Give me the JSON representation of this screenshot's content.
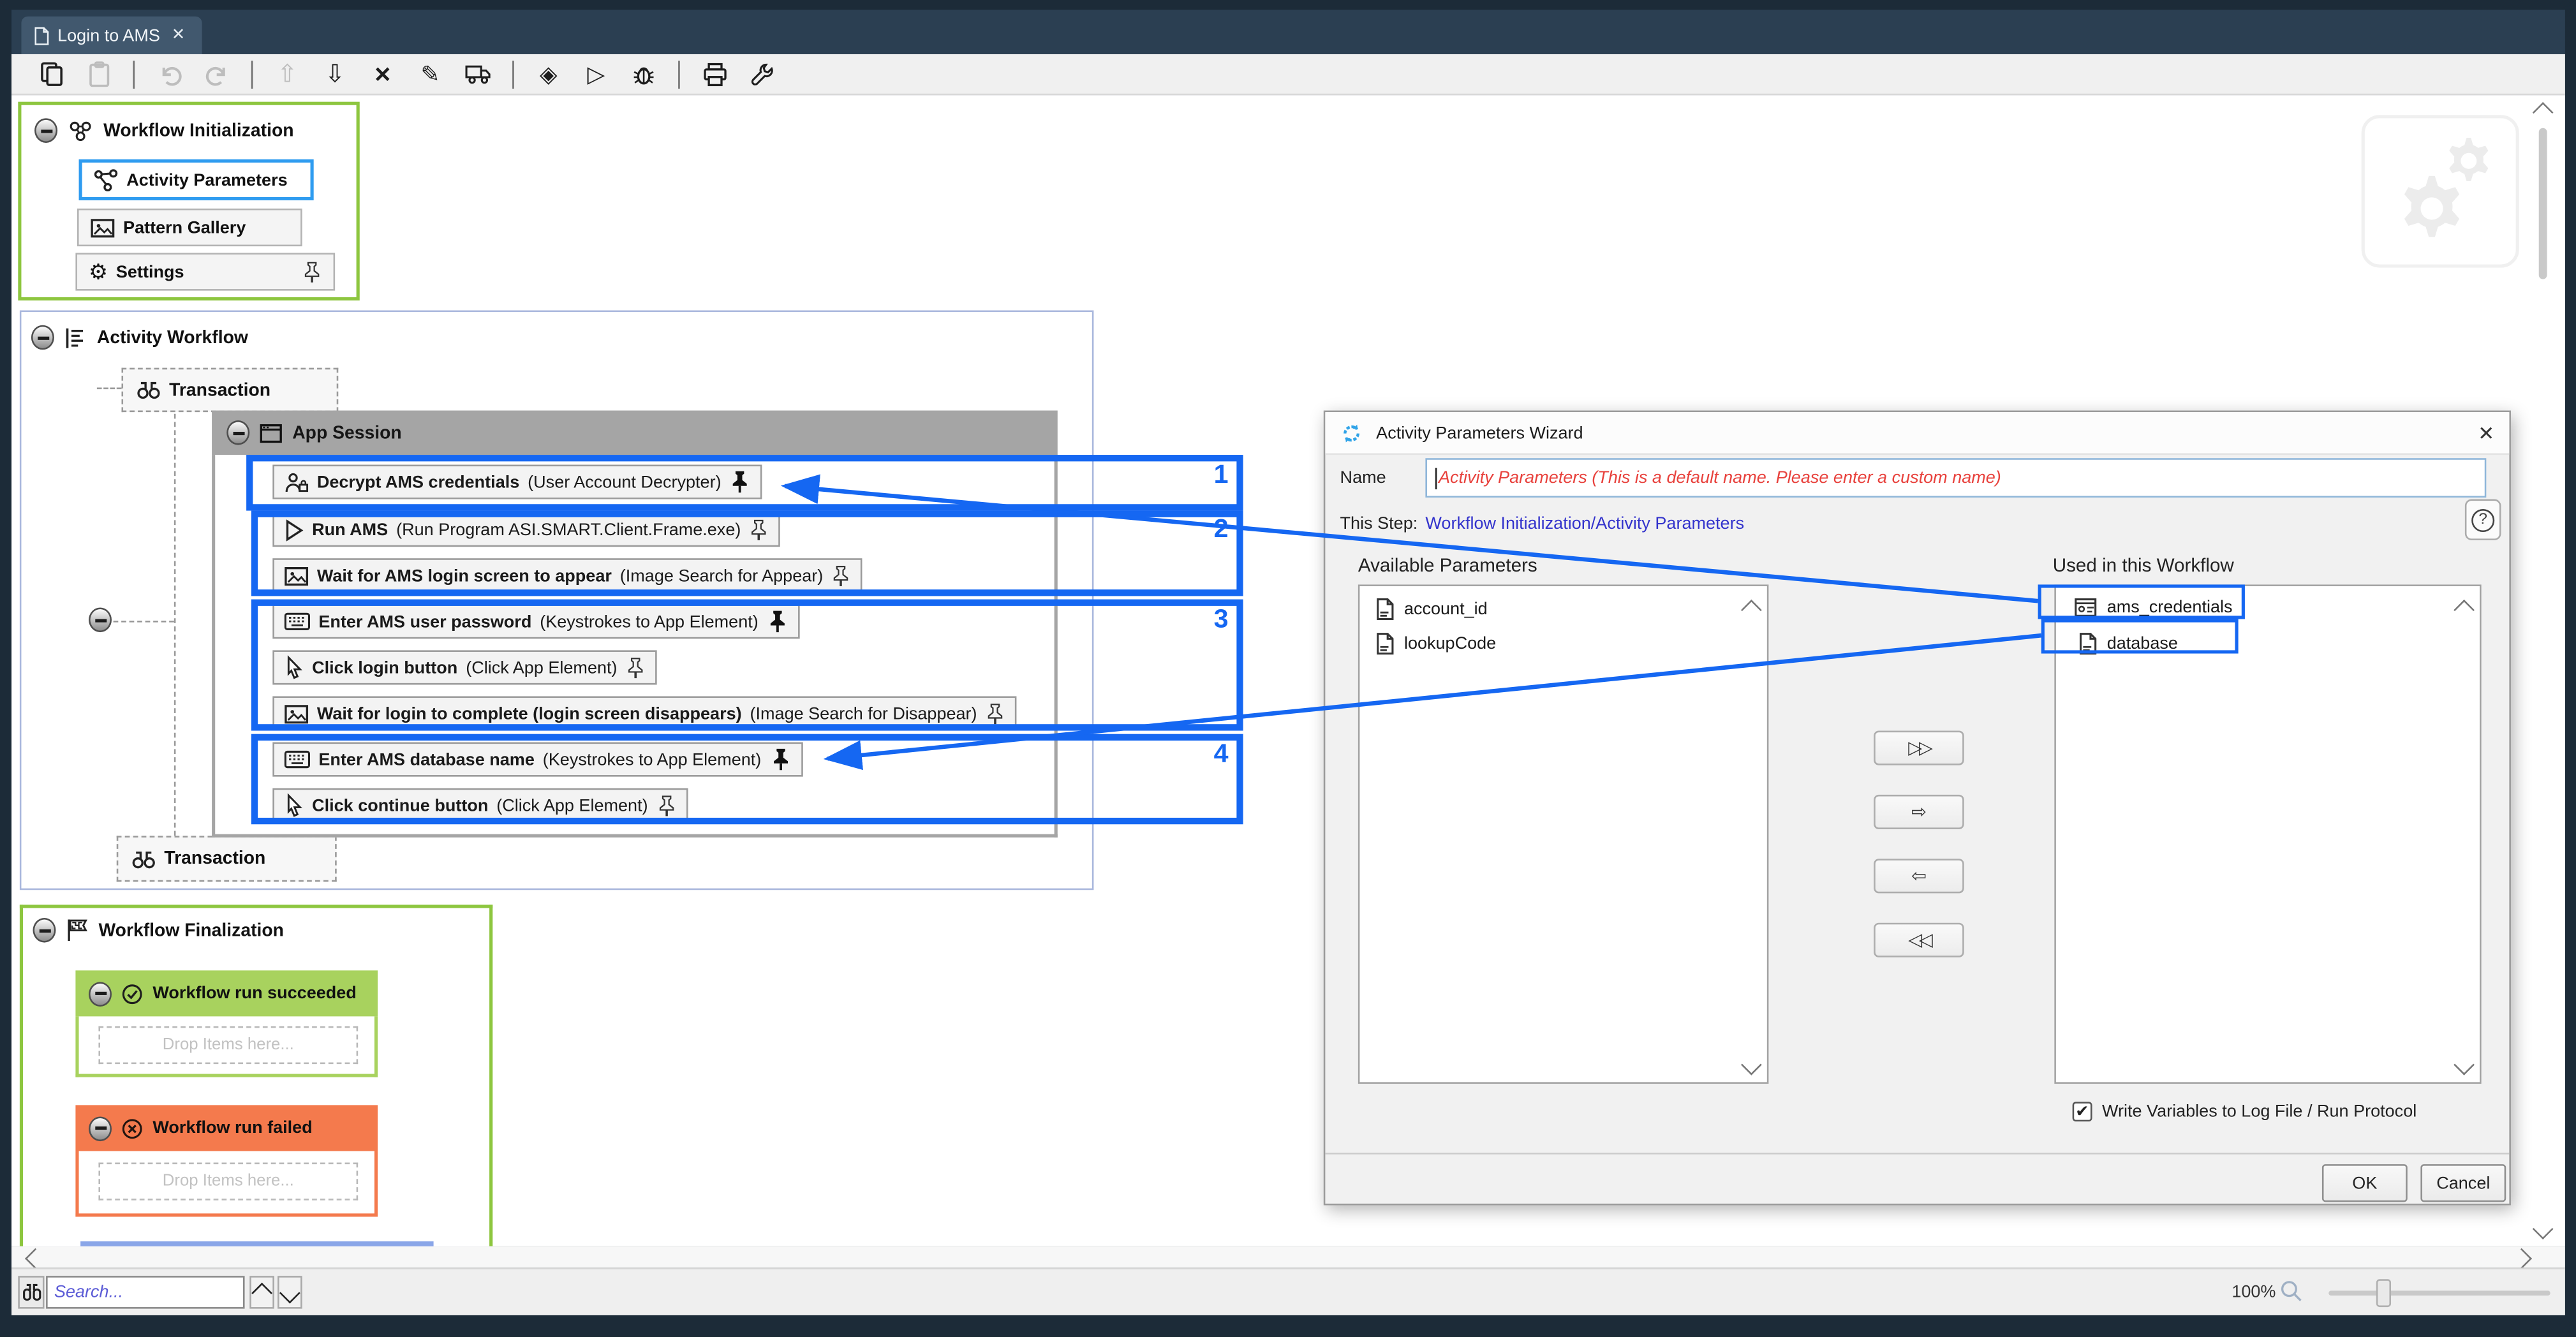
{
  "window": {
    "tab_title": "Login to AMS",
    "tab_close": "✕"
  },
  "toolbar": {
    "icons": [
      "copy-icon",
      "paste-icon",
      "undo-icon",
      "redo-icon",
      "arrow-up-icon",
      "arrow-down-icon",
      "delete-x-icon",
      "edit-pencil-icon",
      "export-truck-icon",
      "milestone-diamond-icon",
      "run-play-icon",
      "debug-bug-icon",
      "print-icon",
      "wrench-icon"
    ]
  },
  "workflow_initialization": {
    "title": "Workflow Initialization",
    "buttons": [
      {
        "label": "Activity Parameters"
      },
      {
        "label": "Pattern Gallery"
      },
      {
        "label": "Settings"
      }
    ]
  },
  "activity_workflow": {
    "title": "Activity Workflow",
    "transaction_top": "Transaction",
    "transaction_bottom": "Transaction",
    "app_session": {
      "title": "App Session",
      "items": [
        {
          "name": "Decrypt AMS credentials",
          "detail": "(User Account Decrypter)",
          "pinned": true
        },
        {
          "name": "Run AMS",
          "detail": "(Run Program ASI.SMART.Client.Frame.exe)",
          "pinned": false
        },
        {
          "name": "Wait for AMS login screen to appear",
          "detail": "(Image Search for Appear)",
          "pinned": false
        },
        {
          "name": "Enter AMS user password",
          "detail": "(Keystrokes to App Element)",
          "pinned": true
        },
        {
          "name": "Click login button",
          "detail": "(Click App Element)",
          "pinned": false
        },
        {
          "name": "Wait for login to complete (login screen disappears)",
          "detail": "(Image Search for Disappear)",
          "pinned": false
        },
        {
          "name": "Enter AMS database name",
          "detail": "(Keystrokes to App Element)",
          "pinned": true
        },
        {
          "name": "Click continue button",
          "detail": "(Click App Element)",
          "pinned": false
        }
      ]
    }
  },
  "annotations": {
    "labels": [
      "1",
      "2",
      "3",
      "4"
    ],
    "color": "#1567f2"
  },
  "workflow_finalization": {
    "title": "Workflow Finalization",
    "succeeded": {
      "title": "Workflow run succeeded",
      "drop": "Drop Items here..."
    },
    "failed": {
      "title": "Workflow run failed",
      "drop": "Drop Items here..."
    }
  },
  "dialog": {
    "title": "Activity Parameters Wizard",
    "close": "✕",
    "name_label": "Name",
    "name_value": "Activity Parameters  (This is a default name. Please enter a custom name)",
    "step_label": "This Step:",
    "step_link": "Workflow Initialization/Activity Parameters",
    "help": "?",
    "available_label": "Available Parameters",
    "available_items": [
      "account_id",
      "lookupCode"
    ],
    "used_label": "Used in this Workflow",
    "used_items": [
      "ams_credentials",
      "database"
    ],
    "transfer_buttons": [
      "▷▷",
      "⇨",
      "⇦",
      "◁◁"
    ],
    "checkbox_label": "Write Variables to Log File / Run Protocol",
    "checkbox_checked": "✔",
    "ok": "OK",
    "cancel": "Cancel"
  },
  "statusbar": {
    "search_placeholder": "Search...",
    "zoom_level": "100%"
  }
}
